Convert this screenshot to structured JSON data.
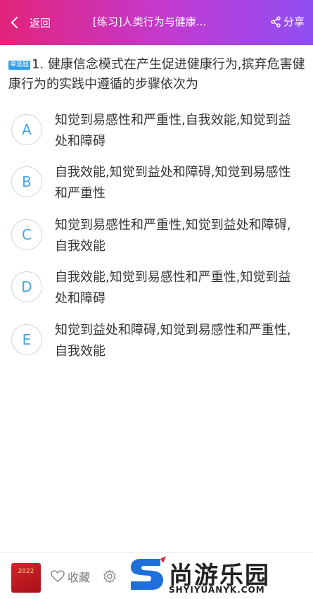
{
  "header": {
    "back_label": "返回",
    "title": "[练习]人类行为与健康...",
    "share_label": "分享"
  },
  "question": {
    "type_tag": "单选题",
    "text": "1. 健康信念模式在产生促进健康行为,摈弃危害健康行为的实践中遵循的步骤依次为"
  },
  "options": [
    {
      "letter": "A",
      "text": "知觉到易感性和严重性,自我效能,知觉到益处和障碍"
    },
    {
      "letter": "B",
      "text": "自我效能,知觉到益处和障碍,知觉到易感性和严重性"
    },
    {
      "letter": "C",
      "text": "知觉到易感性和严重性,知觉到益处和障碍,自我效能"
    },
    {
      "letter": "D",
      "text": "自我效能,知觉到易感性和严重性,知觉到益处和障碍"
    },
    {
      "letter": "E",
      "text": "知觉到益处和障碍,知觉到易感性和严重性,自我效能"
    }
  ],
  "footer": {
    "book_year": "2022",
    "favorite_label": "收藏"
  },
  "watermark": {
    "name": "尚游乐园",
    "url": "SHYIYUANYK.COM"
  },
  "colors": {
    "header_start": "#e2247a",
    "header_end": "#8f4ff3",
    "option_letter": "#4aa3e2",
    "tag_bg": "#2f9ee8"
  }
}
